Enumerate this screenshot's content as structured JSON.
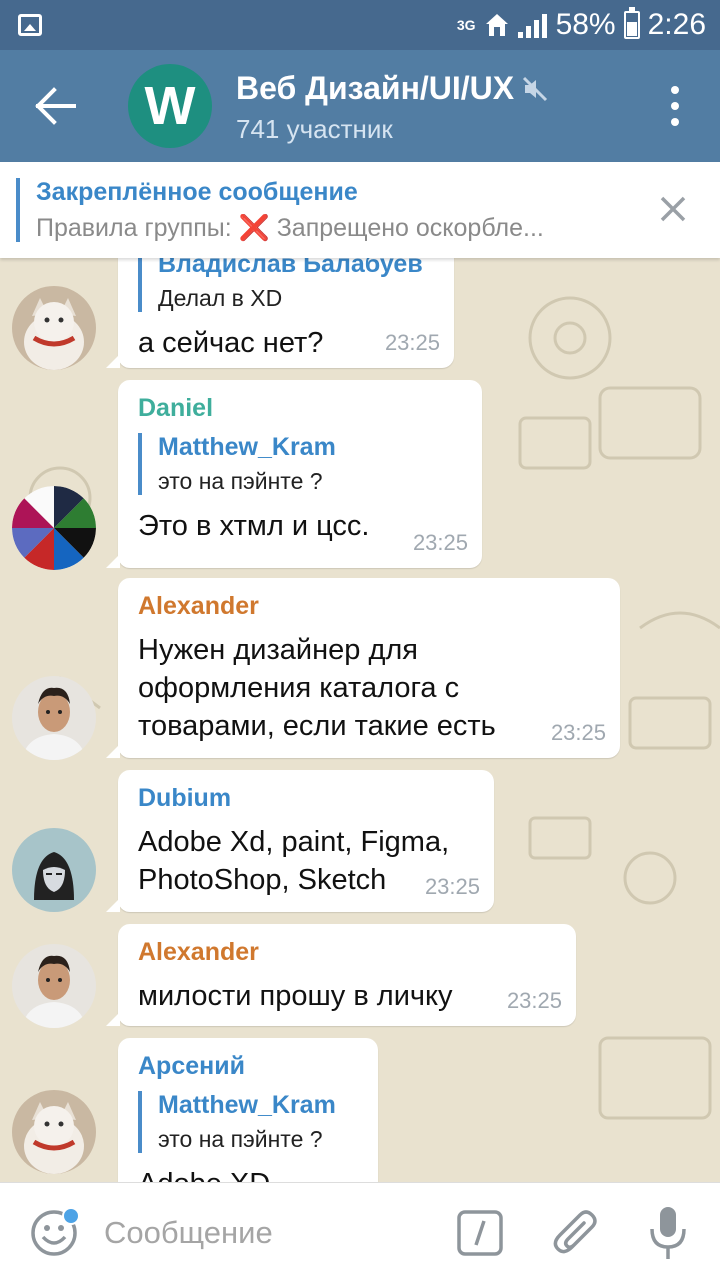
{
  "status_bar": {
    "network": "3G",
    "battery": "58%",
    "time": "2:26",
    "battery_level": 0.58
  },
  "header": {
    "avatar_letter": "W",
    "title": "Веб Дизайн/UI/UX",
    "subtitle": "741 участник",
    "muted": true
  },
  "pinned": {
    "title": "Закреплённое сообщение",
    "text": "Правила группы: ❌ Запрещено оскорбле..."
  },
  "messages": [
    {
      "sender": "",
      "reply_name": "Владислав Балабуев",
      "reply_text": "Делал в XD",
      "text": "а сейчас нет?",
      "time": "23:25"
    },
    {
      "sender": "Daniel",
      "sender_color": "#3fae9c",
      "reply_name": "Matthew_Kram",
      "reply_text": "это на пэйнте ?",
      "text": "Это в хтмл и цсс.",
      "time": "23:25"
    },
    {
      "sender": "Alexander",
      "sender_color": "#d0782e",
      "text_lines": [
        "Нужен дизайнер для",
        "оформления каталога с",
        "товарами, если такие есть"
      ],
      "time": "23:25"
    },
    {
      "sender": "Dubium",
      "sender_color": "#3a87c8",
      "text_lines": [
        "Adobe Xd, paint, Figma,",
        "PhotoShop, Sketch"
      ],
      "time": "23:25"
    },
    {
      "sender": "Alexander",
      "sender_color": "#d0782e",
      "text": "милости прошу в личку",
      "time": "23:25"
    },
    {
      "sender": "Арсений",
      "sender_color": "#3a87c8",
      "reply_name": "Matthew_Kram",
      "reply_text": "это на пэйнте ?",
      "text": "Adobe XD"
    }
  ],
  "input": {
    "placeholder": "Сообщение"
  }
}
